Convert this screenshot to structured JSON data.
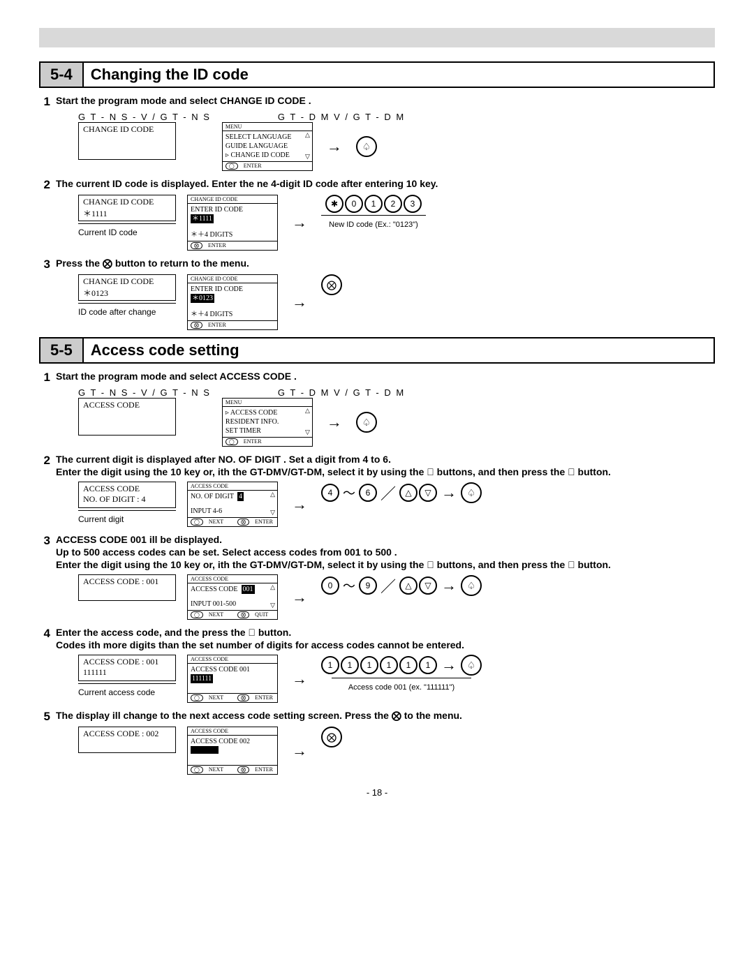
{
  "page_number": "- 18 -",
  "sections": {
    "s54": {
      "num": "5-4",
      "title": "Changing the ID code"
    },
    "s55": {
      "num": "5-5",
      "title": "Access code setting"
    }
  },
  "model_labels": {
    "left": "G T - N S - V / G T - N S",
    "right": "G T - D M V / G T - D M"
  },
  "s54": {
    "step1": {
      "text": "Start the program mode and select  CHANGE ID CODE .",
      "box_left": "CHANGE ID CODE",
      "menu": {
        "title": "MENU",
        "items": [
          "SELECT LANGUAGE",
          "GUIDE LANGUAGE",
          "CHANGE ID CODE"
        ],
        "selected": "CHANGE ID CODE",
        "foot_enter": "ENTER"
      }
    },
    "step2": {
      "text": "The current ID code is displayed. Enter the ne  4-digit ID code after entering 10 key.",
      "box_left_line1": "CHANGE ID CODE",
      "box_left_line2": "＊1111",
      "caption_left": "Current ID code",
      "menu": {
        "title": "CHANGE ID CODE",
        "line1": "ENTER ID CODE",
        "value": "＊1111",
        "hint": "＊＋4 DIGITS",
        "foot_enter": "ENTER"
      },
      "keys": [
        "✱",
        "0",
        "1",
        "2",
        "3"
      ],
      "note": "New ID code (Ex.: \"0123\")"
    },
    "step3": {
      "text": "Press the ⨂ button to return to the menu.",
      "box_left_line1": "CHANGE ID CODE",
      "box_left_line2": "＊0123",
      "caption_left": "ID code after change",
      "menu": {
        "title": "CHANGE ID CODE",
        "line1": "ENTER ID CODE",
        "value": "＊0123",
        "hint": "＊＋4 DIGITS",
        "foot_enter": "ENTER"
      },
      "icon": "⨂"
    }
  },
  "s55": {
    "step1": {
      "text": "Start the program mode and select  ACCESS CODE .",
      "box_left": "ACCESS CODE",
      "menu": {
        "title": "MENU",
        "items": [
          "ACCESS CODE",
          "RESIDENT INFO.",
          "SET TIMER"
        ],
        "selected": "ACCESS CODE",
        "foot_enter": "ENTER"
      }
    },
    "step2": {
      "text1": "The current digit is displayed after  NO. OF DIGIT . Set a digit from 4 to 6.",
      "text2": "Enter the digit using the 10 key or,  ith the GT-DMV/GT-DM, select it by using the ⃝ buttons, and then press the ⃝ button.",
      "box_left_line1": "ACCESS CODE",
      "box_left_line2": "NO. OF DIGIT     : 4",
      "caption_left": "Current digit",
      "menu": {
        "title": "ACCESS CODE",
        "line1": "NO. OF DIGIT",
        "value": "4",
        "hint": "INPUT 4-6",
        "foot_next": "NEXT",
        "foot_enter": "ENTER"
      },
      "keys_range": [
        "4",
        "6"
      ],
      "arrows": [
        "△",
        "▽"
      ]
    },
    "step3": {
      "text1": " ACCESS CODE  001   ill be displayed.",
      "text2": "Up to 500 access codes can be set. Select access codes from  001  to  500 .",
      "text3": "Enter the digit using the 10 key or,  ith the GT-DMV/GT-DM, select it by using the ⃝ buttons, and then press the ⃝ button.",
      "box_left_line1": "ACCESS CODE  : 001",
      "menu": {
        "title": "ACCESS CODE",
        "line1": "ACCESS CODE",
        "value": "001",
        "hint": "INPUT 001-500",
        "foot_next": "NEXT",
        "foot_quit": "QUIT"
      },
      "keys_range": [
        "0",
        "9"
      ],
      "arrows": [
        "△",
        "▽"
      ]
    },
    "step4": {
      "text1": "Enter the access code, and the press the ⃝ button.",
      "text2": "Codes  ith more digits than the set number of digits for access codes cannot be entered.",
      "box_left_line1": "ACCESS CODE  : 001",
      "box_left_line2": "111111",
      "caption_left": "Current access code",
      "menu": {
        "title": "ACCESS CODE",
        "line1": "ACCESS CODE  001",
        "value": "111111",
        "foot_next": "NEXT",
        "foot_enter": "ENTER"
      },
      "keys": [
        "1",
        "1",
        "1",
        "1",
        "1",
        "1"
      ],
      "note": "Access code 001 (ex. \"111111\")"
    },
    "step5": {
      "text": "The display  ill change to the next access code setting screen. Press the ⨂ to the menu.",
      "box_left_line1": "ACCESS CODE  : 002",
      "menu": {
        "title": "ACCESS CODE",
        "line1": "ACCESS CODE  002",
        "value": "",
        "foot_next": "NEXT",
        "foot_enter": "ENTER"
      },
      "icon": "⨂"
    }
  }
}
